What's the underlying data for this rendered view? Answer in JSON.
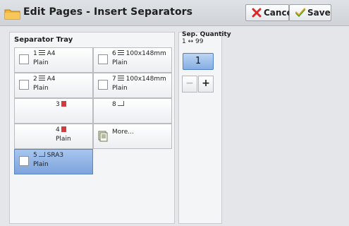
{
  "header": {
    "title": "Edit Pages - Insert Separators",
    "cancel_label": "Cancel",
    "save_label": "Save"
  },
  "separator_tray": {
    "title": "Separator Tray",
    "trays": [
      {
        "number": "1",
        "size": "A4",
        "type": "Plain",
        "selected": false
      },
      {
        "number": "6",
        "size": "100x148mm",
        "type": "Plain",
        "selected": false
      },
      {
        "number": "2",
        "size": "A4",
        "type": "Plain",
        "selected": false
      },
      {
        "number": "7",
        "size": "100x148mm",
        "type": "Plain",
        "selected": false
      },
      {
        "number": "3",
        "size": "",
        "type": "",
        "selected": false
      },
      {
        "number": "8",
        "size": "",
        "type": "",
        "selected": false
      },
      {
        "number": "4",
        "size": "",
        "type": "Plain",
        "selected": false
      },
      {
        "label": "More...",
        "selected": false
      },
      {
        "number": "5",
        "size": "SRA3",
        "type": "Plain",
        "selected": true
      }
    ]
  },
  "quantity": {
    "title": "Sep. Quantity",
    "range": "1 ↔ 99",
    "value": "1",
    "minus": "−",
    "plus": "+"
  }
}
